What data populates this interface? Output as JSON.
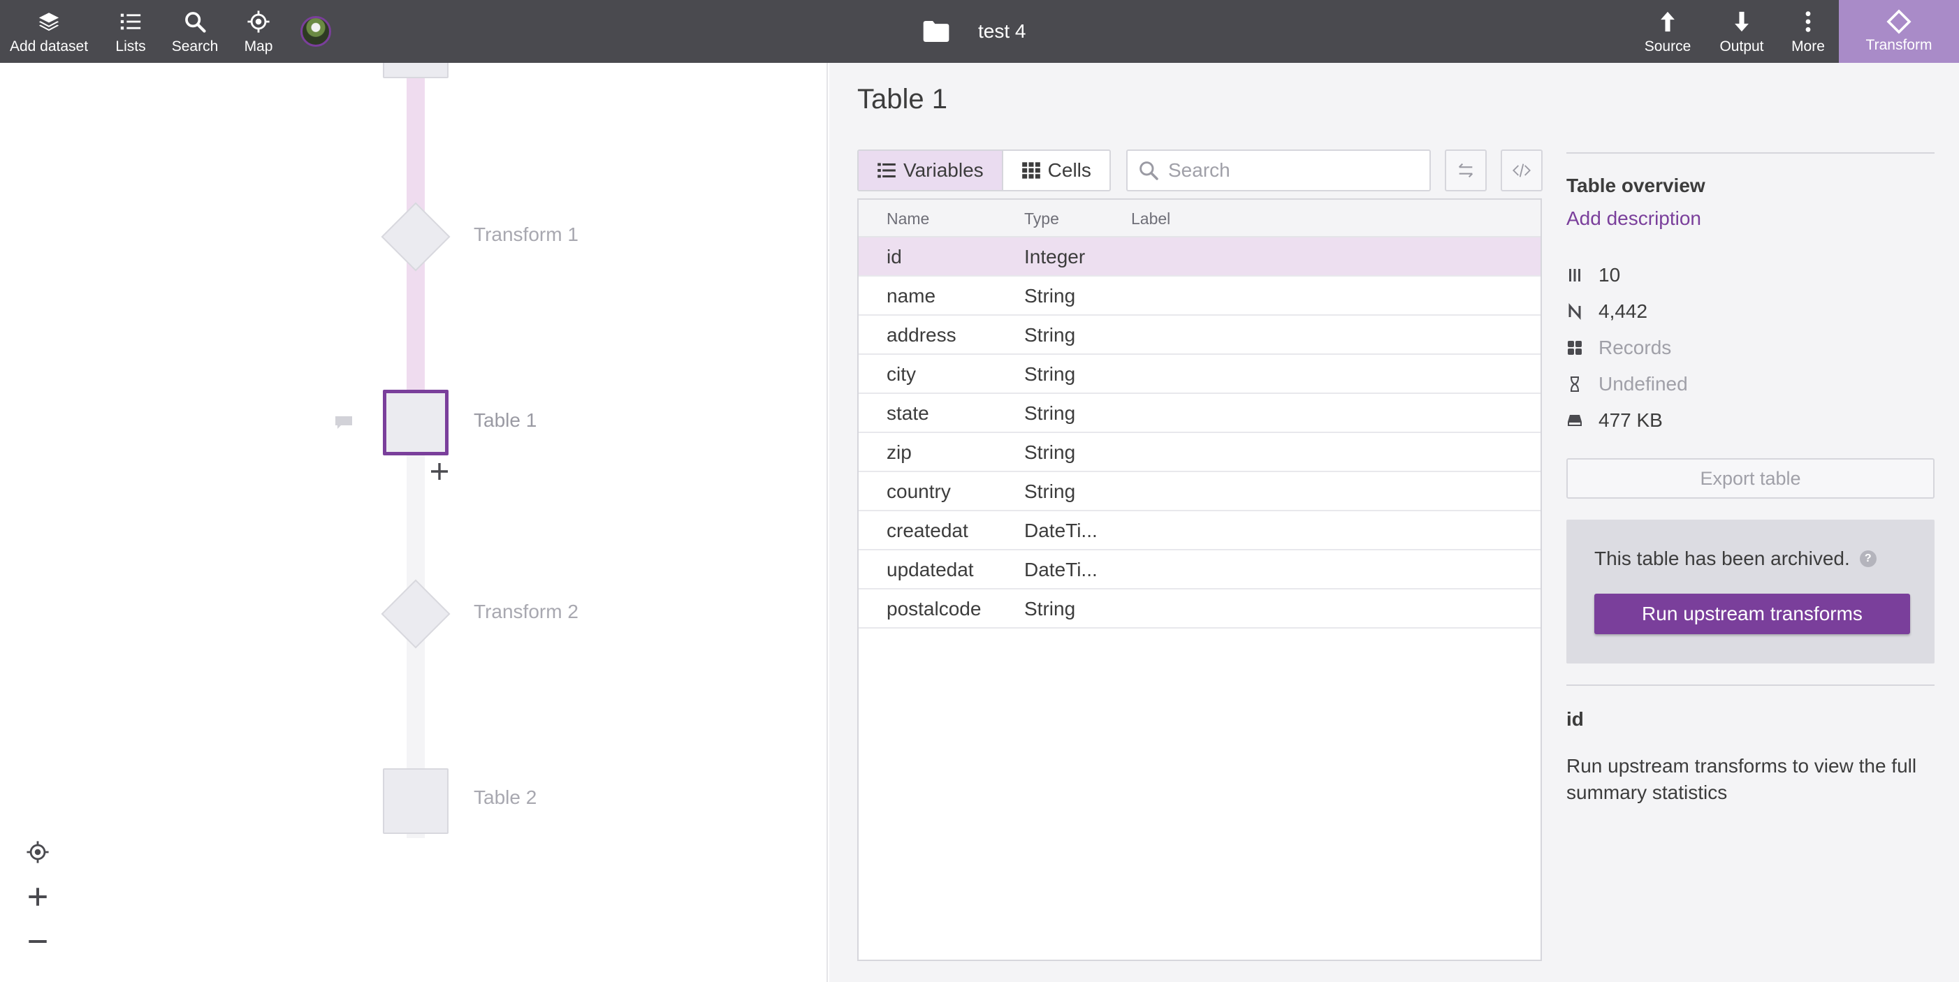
{
  "topbar": {
    "nav": [
      {
        "label": "Add dataset",
        "icon": "layers-icon"
      },
      {
        "label": "Lists",
        "icon": "list-icon"
      },
      {
        "label": "Search",
        "icon": "search-icon"
      },
      {
        "label": "Map",
        "icon": "map-target-icon"
      }
    ],
    "project_name": "test 4",
    "actions": [
      {
        "label": "Source",
        "icon": "arrow-up-icon"
      },
      {
        "label": "Output",
        "icon": "arrow-down-icon"
      },
      {
        "label": "More",
        "icon": "more-vertical-icon"
      }
    ],
    "active_tab": {
      "label": "Transform",
      "icon": "diamond-icon"
    }
  },
  "canvas": {
    "nodes": [
      {
        "label": "Transform 1",
        "kind": "transform"
      },
      {
        "label": "Table 1",
        "kind": "table",
        "active": true
      },
      {
        "label": "Transform 2",
        "kind": "transform"
      },
      {
        "label": "Table 2",
        "kind": "table"
      }
    ],
    "controls": [
      "recenter-icon",
      "zoom-in-icon",
      "zoom-out-icon"
    ]
  },
  "panel": {
    "title": "Table 1",
    "tabs": [
      {
        "label": "Variables",
        "selected": true
      },
      {
        "label": "Cells",
        "selected": false
      }
    ],
    "search_placeholder": "Search",
    "columns": [
      "Name",
      "Type",
      "Label"
    ],
    "variables": [
      {
        "name": "id",
        "type": "Integer",
        "label": ""
      },
      {
        "name": "name",
        "type": "String",
        "label": ""
      },
      {
        "name": "address",
        "type": "String",
        "label": ""
      },
      {
        "name": "city",
        "type": "String",
        "label": ""
      },
      {
        "name": "state",
        "type": "String",
        "label": ""
      },
      {
        "name": "zip",
        "type": "String",
        "label": ""
      },
      {
        "name": "country",
        "type": "String",
        "label": ""
      },
      {
        "name": "createdat",
        "type": "DateTi...",
        "label": ""
      },
      {
        "name": "updatedat",
        "type": "DateTi...",
        "label": ""
      },
      {
        "name": "postalcode",
        "type": "String",
        "label": ""
      }
    ],
    "selected_variable_index": 0
  },
  "overview": {
    "title": "Table overview",
    "add_description": "Add description",
    "stats": {
      "variables": "10",
      "rows": "4,442",
      "layout": "Records",
      "temporal": "Undefined",
      "size": "477 KB"
    },
    "export_label": "Export table",
    "archived_message": "This table has been archived.",
    "help_glyph": "?",
    "run_label": "Run upstream transforms",
    "selected_variable": "id",
    "variable_note": "Run upstream transforms to view the full summary statistics"
  },
  "colors": {
    "topbar": "#4a4a4f",
    "accent": "#7a3f9b",
    "active_tab": "#a98bc8",
    "selected_row": "#eddff0"
  }
}
